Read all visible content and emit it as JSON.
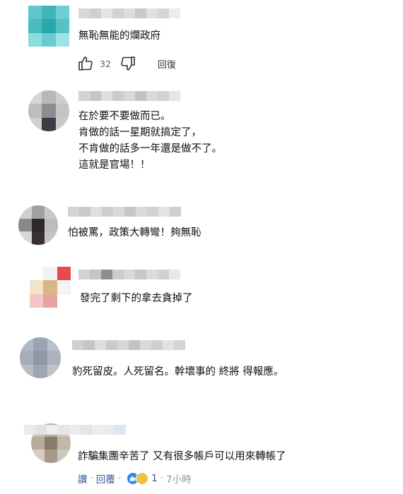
{
  "comments": [
    {
      "text": "無恥無能的爛政府",
      "likes": "32",
      "reply_label": "回復"
    },
    {
      "text": "在於要不要做而已。\n肯做的話一星期就搞定了，\n不肯做的話多一年還是做不了。\n這就是官場！！"
    },
    {
      "text": "怕被罵，政策大轉彎！夠無恥"
    },
    {
      "text": "發完了剩下的拿去貪掉了"
    },
    {
      "text": "豹死留皮。人死留名。幹壞事的 終將 得報應。"
    },
    {
      "text": "詐騙集團辛苦了 又有很多帳戶可以用來轉帳了",
      "like_label": "讚",
      "reply_label": "回覆",
      "reaction_count": "1",
      "time": "7小時"
    }
  ],
  "colors": {
    "link": "#385898",
    "meta": "#606060",
    "like_reaction": "#2d88ff"
  },
  "icons": [
    "thumbs-up-icon",
    "thumbs-down-icon",
    "like-reaction-icon",
    "love-reaction-icon"
  ]
}
